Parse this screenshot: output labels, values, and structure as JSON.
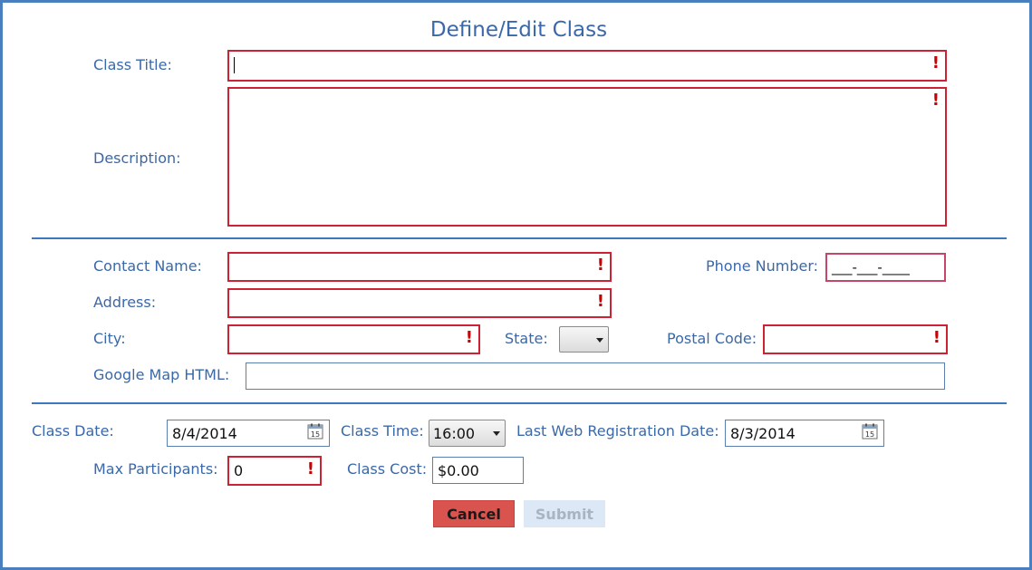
{
  "dialog": {
    "title": "Define/Edit Class"
  },
  "form": {
    "class_title": {
      "label": "Class Title:",
      "value": ""
    },
    "description": {
      "label": "Description:",
      "value": ""
    },
    "contact_name": {
      "label": "Contact Name:",
      "value": ""
    },
    "phone_number": {
      "label": "Phone Number:",
      "value": "___-___-____"
    },
    "address": {
      "label": "Address:",
      "value": ""
    },
    "city": {
      "label": "City:",
      "value": ""
    },
    "state": {
      "label": "State:",
      "value": ""
    },
    "postal_code": {
      "label": "Postal Code:",
      "value": ""
    },
    "google_map_html": {
      "label": "Google Map HTML:",
      "value": ""
    },
    "class_date": {
      "label": "Class Date:",
      "value": "8/4/2014"
    },
    "class_time": {
      "label": "Class Time:",
      "value": "16:00"
    },
    "last_web_registration_date": {
      "label": "Last Web Registration Date:",
      "value": "8/3/2014"
    },
    "max_participants": {
      "label": "Max Participants:",
      "value": "0"
    },
    "class_cost": {
      "label": "Class Cost:",
      "value": "$0.00"
    }
  },
  "validation": {
    "required_marker": "!"
  },
  "calendar_icon": {
    "day": "15"
  },
  "buttons": {
    "cancel": "Cancel",
    "submit": "Submit"
  },
  "colors": {
    "label": "#3a68a8",
    "required_border": "#cc2233",
    "divider": "#3f77bd",
    "cancel_bg": "#d9534f",
    "submit_bg": "#dce8f6"
  }
}
